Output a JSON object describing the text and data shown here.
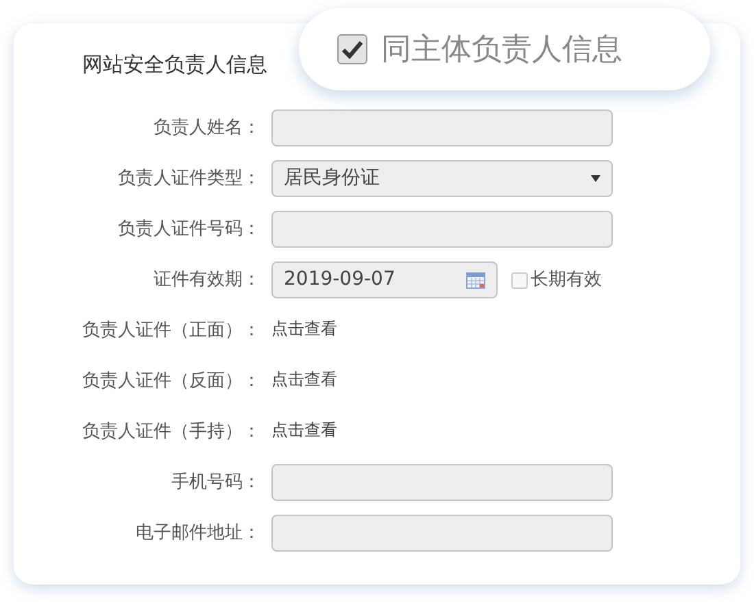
{
  "section_title": "网站安全负责人信息",
  "same_as_subject": {
    "label": "同主体负责人信息",
    "checked": true
  },
  "fields": [
    {
      "kind": "text",
      "label": "负责人姓名："
    },
    {
      "kind": "select",
      "label": "负责人证件类型：",
      "value": "居民身份证"
    },
    {
      "kind": "text",
      "label": "负责人证件号码："
    },
    {
      "kind": "date",
      "label": "证件有效期：",
      "value": "2019-09-07",
      "long_term": {
        "label": "长期有效",
        "checked": false
      }
    },
    {
      "kind": "link",
      "label": "负责人证件（正面）：",
      "link": "点击查看"
    },
    {
      "kind": "link",
      "label": "负责人证件（反面）：",
      "link": "点击查看"
    },
    {
      "kind": "link",
      "label": "负责人证件（手持）：",
      "link": "点击查看"
    },
    {
      "kind": "text",
      "label": "手机号码："
    },
    {
      "kind": "text",
      "label": "电子邮件地址："
    }
  ]
}
